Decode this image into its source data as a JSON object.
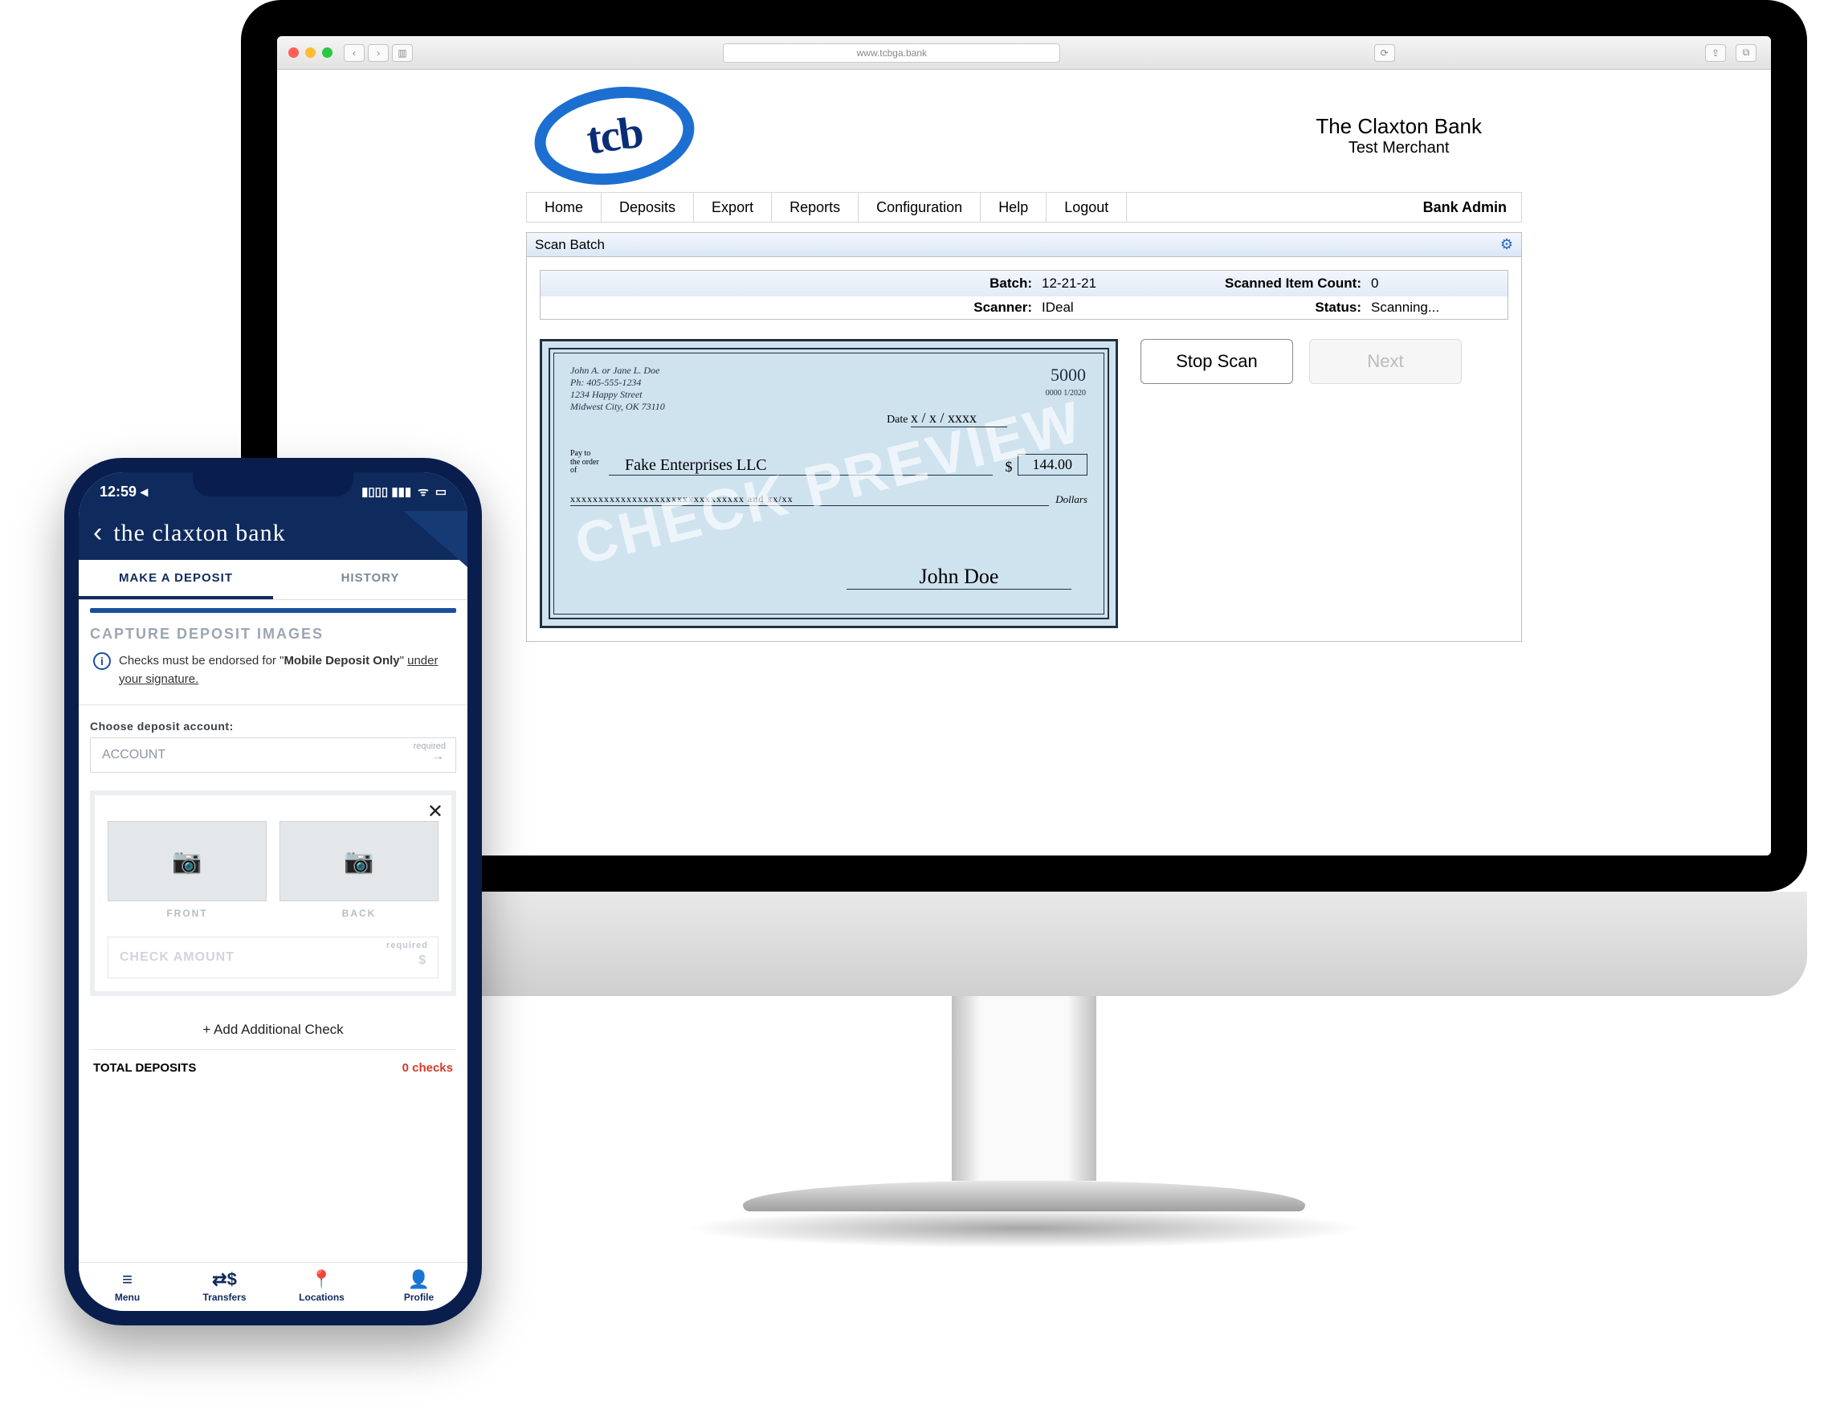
{
  "desktop": {
    "url": "www.tcbga.bank",
    "logo_text": "tcb",
    "bank_name": "The Claxton Bank",
    "merchant": "Test Merchant",
    "menu": [
      "Home",
      "Deposits",
      "Export",
      "Reports",
      "Configuration",
      "Help",
      "Logout"
    ],
    "user_label": "Bank Admin",
    "panel_title": "Scan Batch",
    "info": {
      "batch_label": "Batch:",
      "batch_value": "12-21-21",
      "count_label": "Scanned Item Count:",
      "count_value": "0",
      "scanner_label": "Scanner:",
      "scanner_value": "IDeal",
      "status_label": "Status:",
      "status_value": "Scanning..."
    },
    "check": {
      "watermark": "CHECK PREVIEW",
      "addr1": "John A. or Jane L. Doe",
      "addr2": "Ph: 405-555-1234",
      "addr3": "1234 Happy Street",
      "addr4": "Midwest City, OK 73110",
      "number": "5000",
      "riddle": "0000  1/2020",
      "date_label": "Date",
      "date_value": "x / x / xxxx",
      "pay_label": "Pay to the order of",
      "payee": "Fake Enterprises LLC",
      "amount": "144.00",
      "amount_currency": "$",
      "words": "xxxxxxxxxxxxxxxxxxxxxxxxxxxxxxx and xx/xx",
      "dollars": "Dollars",
      "signature": "John Doe"
    },
    "buttons": {
      "stop": "Stop Scan",
      "next": "Next"
    }
  },
  "phone": {
    "time": "12:59 ◂",
    "carrier_icons": "▮▮▮  ▸▸",
    "header_back": "‹",
    "header_title": "the claxton bank",
    "tabs": {
      "deposit": "MAKE A DEPOSIT",
      "history": "HISTORY"
    },
    "section_title": "CAPTURE DEPOSIT IMAGES",
    "notice_pre": "Checks must be endorsed for \"",
    "notice_bold": "Mobile Deposit Only",
    "notice_post": "\" ",
    "notice_underline": "under your signature.",
    "choose_label": "Choose deposit account:",
    "account_placeholder": "ACCOUNT",
    "required": "required",
    "front": "FRONT",
    "back": "BACK",
    "amount_placeholder": "CHECK AMOUNT",
    "currency": "$",
    "add_check": "+ Add Additional Check",
    "total_label": "TOTAL DEPOSITS",
    "total_count": "0 checks",
    "nav": [
      {
        "icon": "≡",
        "label": "Menu"
      },
      {
        "icon": "⇄$",
        "label": "Transfers"
      },
      {
        "icon": "📍",
        "label": "Locations"
      },
      {
        "icon": "👤",
        "label": "Profile"
      }
    ]
  }
}
